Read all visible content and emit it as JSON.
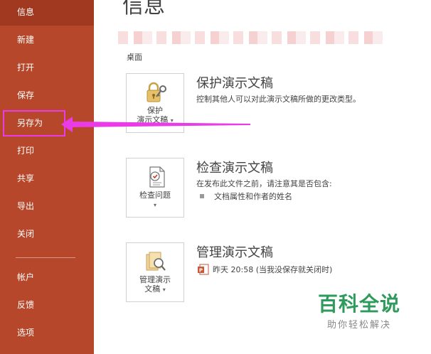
{
  "sidebar": {
    "items": [
      {
        "label": "信息",
        "active": true
      },
      {
        "label": "新建"
      },
      {
        "label": "打开"
      },
      {
        "label": "保存"
      },
      {
        "label": "另存为"
      },
      {
        "label": "打印"
      },
      {
        "label": "共享"
      },
      {
        "label": "导出"
      },
      {
        "label": "关闭"
      },
      {
        "label": "帐户"
      },
      {
        "label": "反馈"
      },
      {
        "label": "选项"
      }
    ],
    "bg_color": "#b7472a"
  },
  "main": {
    "title": "信息",
    "location": "桌面",
    "sections": [
      {
        "button_line1": "保护",
        "button_line2": "演示文稿",
        "title": "保护演示文稿",
        "desc": "控制其他人可以对此演示文稿所做的更改类型。",
        "icon": "lock-key-icon"
      },
      {
        "button_line1": "检查问题",
        "button_line2": "",
        "title": "检查演示文稿",
        "desc": "在发布此文件之前，请注意其是否包含:",
        "bullet": "文档属性和作者的姓名",
        "icon": "inspect-document-icon"
      },
      {
        "button_line1": "管理演示",
        "button_line2": "文稿",
        "title": "管理演示文稿",
        "version": "昨天 20:58 (当我没保存就关闭时)",
        "icon": "manage-presentation-icon"
      }
    ]
  },
  "watermark": {
    "title": "百科全说",
    "subtitle": "助你轻松解决"
  },
  "annotation_color": "#e93be6"
}
